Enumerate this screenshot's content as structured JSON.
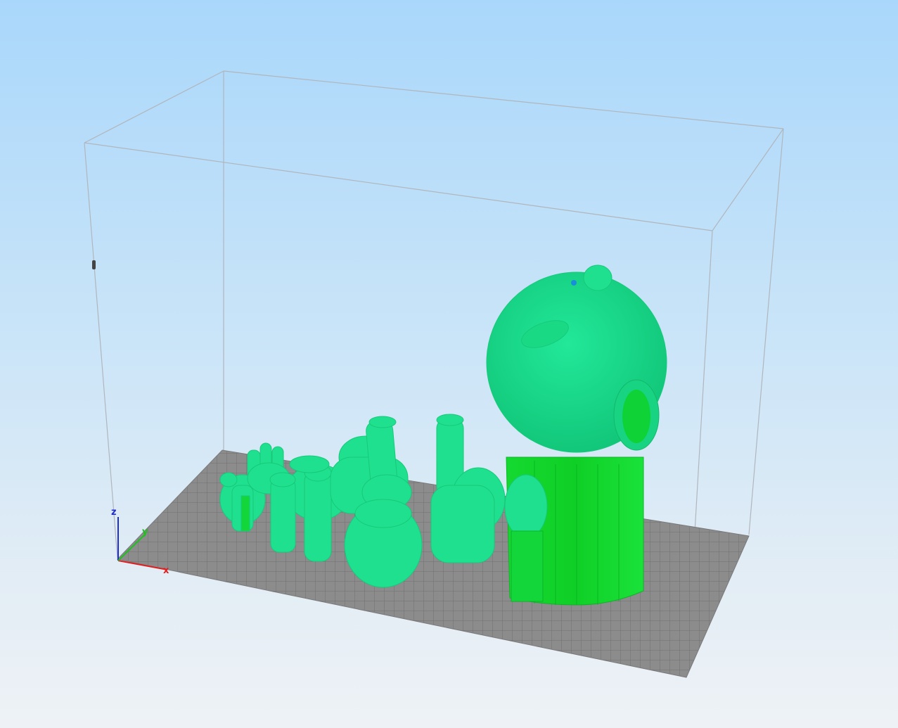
{
  "viewport": {
    "background_top": "#a9d7fb",
    "background_bottom": "#eef2f6",
    "bed_color": "#8a8a8a",
    "bed_grid_color": "#6e6e6e",
    "model_color": "#1fe28e",
    "support_color": "#10d92a",
    "build_volume_edge_color": "#aab0b8"
  },
  "axes": {
    "x_label": "x",
    "y_label": "y",
    "z_label": "z",
    "x_color": "#e02020",
    "y_color": "#20c020",
    "z_color": "#2030d0"
  },
  "layer_slider": {
    "icon": "slider-handle"
  }
}
